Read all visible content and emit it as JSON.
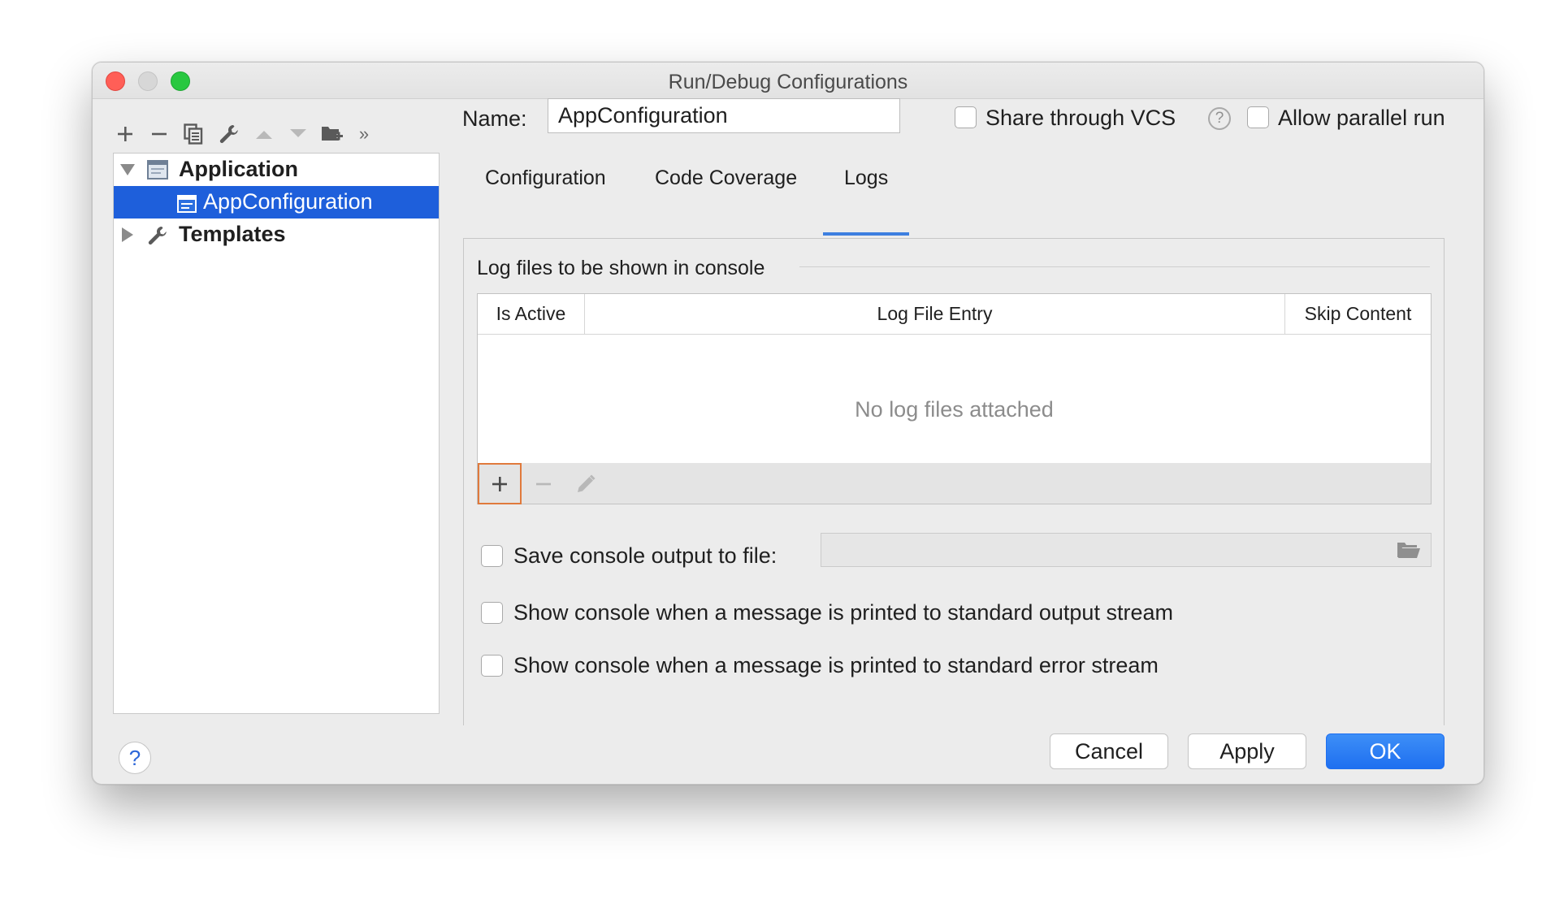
{
  "window": {
    "title": "Run/Debug Configurations"
  },
  "left_toolbar": {
    "icons": [
      "add-icon",
      "remove-icon",
      "copy-icon",
      "wrench-icon",
      "move-up-icon",
      "move-down-icon",
      "new-folder-icon",
      "more-icon"
    ],
    "more_glyph": "»"
  },
  "tree": {
    "items": [
      {
        "label": "Application",
        "expanded": true,
        "icon": "application-icon"
      },
      {
        "label": "AppConfiguration",
        "selected": true,
        "icon": "config-icon"
      },
      {
        "label": "Templates",
        "expanded": false,
        "icon": "wrench-icon"
      }
    ]
  },
  "name_row": {
    "label": "Name:",
    "value": "AppConfiguration",
    "share_vcs_label": "Share through VCS",
    "share_vcs_checked": false,
    "help_glyph": "?",
    "allow_parallel_label": "Allow parallel run",
    "allow_parallel_checked": false
  },
  "tabs": [
    {
      "label": "Configuration"
    },
    {
      "label": "Code Coverage"
    },
    {
      "label": "Logs",
      "active": true
    }
  ],
  "logs": {
    "group_title": "Log files to be shown in console",
    "columns": [
      "Is Active",
      "Log File Entry",
      "Skip Content"
    ],
    "empty_text": "No log files attached",
    "toolbar": [
      "add-icon",
      "remove-icon",
      "edit-icon"
    ],
    "save_output_label": "Save console output to file:",
    "save_output_checked": false,
    "save_output_path": "",
    "show_stdout_label": "Show console when a message is printed to standard output stream",
    "show_stdout_checked": false,
    "show_stderr_label": "Show console when a message is printed to standard error stream",
    "show_stderr_checked": false
  },
  "footer": {
    "help_glyph": "?",
    "cancel_label": "Cancel",
    "apply_label": "Apply",
    "ok_label": "OK"
  },
  "colors": {
    "selection": "#1e5fdb",
    "primary_button": "#1f6ff0",
    "tab_underline": "#3d7fe0",
    "focus_ring": "#e07a3c"
  }
}
